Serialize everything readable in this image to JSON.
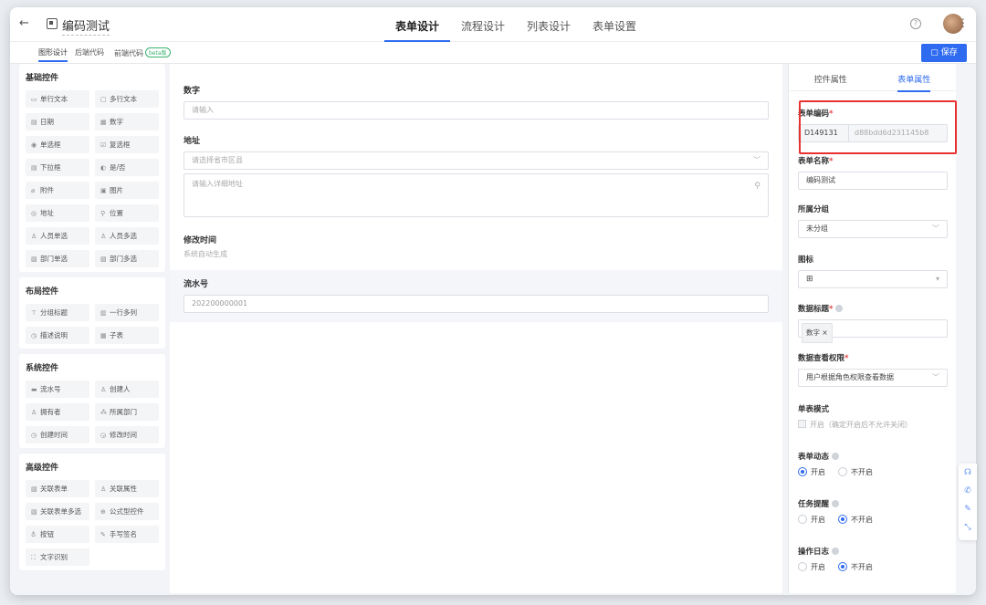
{
  "topbar": {
    "back_icon": "←",
    "title": "编码测试",
    "tabs": [
      {
        "label": "表单设计",
        "active": true
      },
      {
        "label": "流程设计",
        "active": false
      },
      {
        "label": "列表设计",
        "active": false
      },
      {
        "label": "表单设置",
        "active": false
      }
    ],
    "help_icon": "?",
    "more_icon": "⋮"
  },
  "subbar": {
    "tabs": [
      "图形设计",
      "后端代码",
      "前端代码"
    ],
    "beta": "beta版",
    "save_label": "保存",
    "save_icon": "▢"
  },
  "palette": [
    {
      "title": "基础控件",
      "items": [
        {
          "icon": "▭",
          "label": "单行文本"
        },
        {
          "icon": "▢",
          "label": "多行文本"
        },
        {
          "icon": "▤",
          "label": "日期"
        },
        {
          "icon": "▦",
          "label": "数字"
        },
        {
          "icon": "◉",
          "label": "单选框"
        },
        {
          "icon": "☑",
          "label": "复选框"
        },
        {
          "icon": "▤",
          "label": "下拉框"
        },
        {
          "icon": "◐",
          "label": "是/否"
        },
        {
          "icon": "⌀",
          "label": "附件"
        },
        {
          "icon": "▣",
          "label": "图片"
        },
        {
          "icon": "◎",
          "label": "地址"
        },
        {
          "icon": "⚲",
          "label": "位置"
        },
        {
          "icon": "♙",
          "label": "人员单选"
        },
        {
          "icon": "♙",
          "label": "人员多选"
        },
        {
          "icon": "▨",
          "label": "部门单选"
        },
        {
          "icon": "▨",
          "label": "部门多选"
        }
      ]
    },
    {
      "title": "布局控件",
      "items": [
        {
          "icon": "⊤",
          "label": "分组标题"
        },
        {
          "icon": "▥",
          "label": "一行多列"
        },
        {
          "icon": "◷",
          "label": "描述说明"
        },
        {
          "icon": "▦",
          "label": "子表"
        }
      ]
    },
    {
      "title": "系统控件",
      "items": [
        {
          "icon": "▬",
          "label": "流水号"
        },
        {
          "icon": "♙",
          "label": "创建人"
        },
        {
          "icon": "♙",
          "label": "拥有者"
        },
        {
          "icon": "⁂",
          "label": "所属部门"
        },
        {
          "icon": "◷",
          "label": "创建时间"
        },
        {
          "icon": "◶",
          "label": "修改时间"
        }
      ]
    },
    {
      "title": "高级控件",
      "items": [
        {
          "icon": "▧",
          "label": "关联表单"
        },
        {
          "icon": "♙",
          "label": "关联属性"
        },
        {
          "icon": "▧",
          "label": "关联表单多选"
        },
        {
          "icon": "⊕",
          "label": "公式型控件"
        },
        {
          "icon": "♁",
          "label": "按钮"
        },
        {
          "icon": "✎",
          "label": "手写签名"
        },
        {
          "icon": "⛶",
          "label": "文字识别"
        }
      ]
    }
  ],
  "canvas": {
    "number": {
      "label": "数字",
      "placeholder": "请输入"
    },
    "address": {
      "label": "地址",
      "region_placeholder": "请选择省市区县",
      "detail_placeholder": "请输入详细地址"
    },
    "modified": {
      "label": "修改时间",
      "hint": "系统自动生成"
    },
    "serial": {
      "label": "流水号",
      "value": "202200000001"
    }
  },
  "props": {
    "tabs": [
      "控件属性",
      "表单属性"
    ],
    "form_code": {
      "label": "表单编码",
      "prefix": "D149131",
      "value": "d88bdd6d231145b8"
    },
    "form_name": {
      "label": "表单名称",
      "value": "编码测试"
    },
    "group": {
      "label": "所属分组",
      "value": "未分组"
    },
    "icon": {
      "label": "图标"
    },
    "data_title": {
      "label": "数据标题",
      "tag": "数字 ×"
    },
    "view_perm": {
      "label": "数据查看权限",
      "value": "用户根据角色权限查看数据"
    },
    "single_mode": {
      "label": "单表模式",
      "option": "开启（确定开启后不允许关闭）"
    },
    "form_dynamic": {
      "label": "表单动态",
      "on": "开启",
      "off": "不开启",
      "selected": "on"
    },
    "task_remind": {
      "label": "任务提醒",
      "on": "开启",
      "off": "不开启",
      "selected": "off"
    },
    "op_log": {
      "label": "操作日志",
      "on": "开启",
      "off": "不开启",
      "selected": "off"
    }
  },
  "colors": {
    "accent": "#2f6bf0",
    "highlight": "#e8322f"
  }
}
